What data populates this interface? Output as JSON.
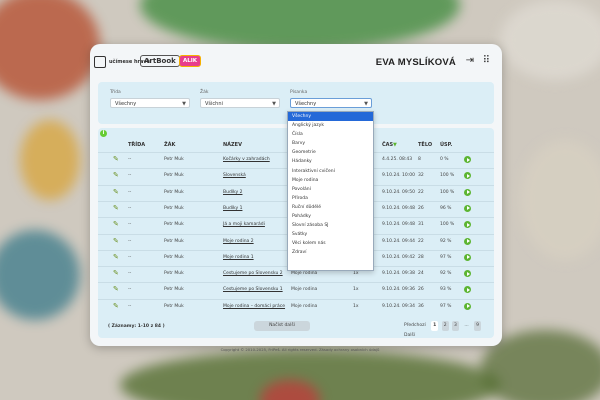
{
  "header": {
    "logo_ucimese": "učímese hravě",
    "logo_artbook": "ArtBook",
    "logo_kids": "ALIK",
    "user_name": "EVA MYSLÍKOVÁ"
  },
  "filters": [
    {
      "label": "Třída",
      "value": "Všechny"
    },
    {
      "label": "Žák",
      "value": "Všichni"
    },
    {
      "label": "Písanka",
      "value": "Všechny"
    }
  ],
  "table": {
    "headers": [
      "TŘÍDA",
      "ŽÁK",
      "NÁZEV",
      "ČAS",
      "TĚLO",
      "ÚSP."
    ],
    "rows": [
      {
        "trida": "--",
        "zak": "Petr Muk",
        "nazev": "Kočárky v zahradách",
        "tema": "",
        "x": "",
        "cas": "4.4.25. 08:43",
        "telo": "8",
        "usp": "0 %"
      },
      {
        "trida": "--",
        "zak": "Petr Muk",
        "nazev": "Slovenská",
        "tema": "",
        "x": "",
        "cas": "9.10.24. 10:00",
        "telo": "32",
        "usp": "100 %"
      },
      {
        "trida": "--",
        "zak": "Petr Muk",
        "nazev": "Budíky 2",
        "tema": "",
        "x": "",
        "cas": "9.10.24. 09:50",
        "telo": "22",
        "usp": "100 %"
      },
      {
        "trida": "--",
        "zak": "Petr Muk",
        "nazev": "Budíky 1",
        "tema": "",
        "x": "",
        "cas": "9.10.24. 09:48",
        "telo": "26",
        "usp": "96 %"
      },
      {
        "trida": "--",
        "zak": "Petr Muk",
        "nazev": "Já a moji kamarádi",
        "tema": "",
        "x": "",
        "cas": "9.10.24. 09:48",
        "telo": "31",
        "usp": "100 %"
      },
      {
        "trida": "--",
        "zak": "Petr Muk",
        "nazev": "Moje rodina 2",
        "tema": "",
        "x": "",
        "cas": "9.10.24. 09:44",
        "telo": "22",
        "usp": "92 %"
      },
      {
        "trida": "--",
        "zak": "Petr Muk",
        "nazev": "Moje rodina 1",
        "tema": "",
        "x": "",
        "cas": "9.10.24. 09:42",
        "telo": "28",
        "usp": "97 %"
      },
      {
        "trida": "--",
        "zak": "Petr Muk",
        "nazev": "Cestujeme po Slovensku 2",
        "tema": "Moje rodina",
        "x": "1x",
        "cas": "9.10.24. 09:38",
        "telo": "24",
        "usp": "92 %"
      },
      {
        "trida": "--",
        "zak": "Petr Muk",
        "nazev": "Cestujeme po Slovensku 1",
        "tema": "Moje rodina",
        "x": "1x",
        "cas": "9.10.24. 09:36",
        "telo": "26",
        "usp": "93 %"
      },
      {
        "trida": "--",
        "zak": "Petr Muk",
        "nazev": "Moje rodina – domácí práce",
        "tema": "Moje rodina",
        "x": "1x",
        "cas": "9.10.24. 09:34",
        "telo": "36",
        "usp": "97 %"
      }
    ]
  },
  "records": "( Záznamy: 1-10 z 84 )",
  "more_button": "Načíst další",
  "pager": {
    "prev": "Předchozí",
    "pages": [
      "1",
      "2",
      "3",
      "...",
      "9"
    ],
    "next": "Další"
  },
  "dropdown_options": [
    "Všechny",
    "Anglický jazyk",
    "Čísla",
    "Barvy",
    "Geometrie",
    "Hádanky",
    "Interaktivní cvičení",
    "Moje rodina",
    "Povolání",
    "Příroda",
    "Ruční dödělé",
    "Pohádky",
    "Slovní zásoba SJ",
    "Svátky",
    "Věci kolem nás",
    "Zdraví"
  ],
  "footer": "Copyright © 2010-2025, FriPeš. All rights reserved. Zásady ochrany osobních údajů",
  "colors": {
    "accent": "#2469d8",
    "play": "#5cb531",
    "panel_blue": "#dbeef6"
  }
}
